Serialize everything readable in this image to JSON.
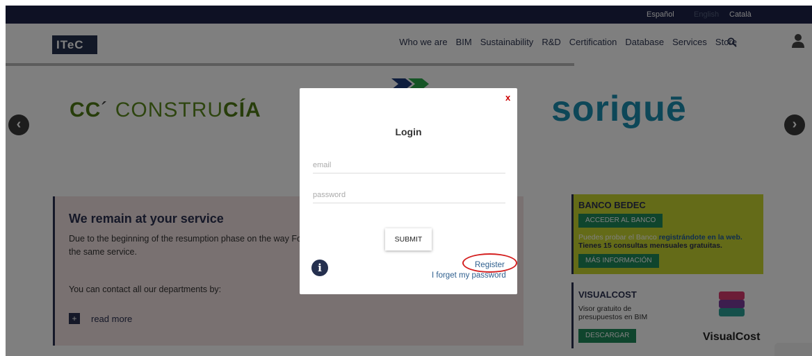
{
  "languages": [
    {
      "label": "Español",
      "active": true
    },
    {
      "label": "English",
      "active": false
    },
    {
      "label": "Català",
      "active": true
    }
  ],
  "header": {
    "logo": "ITeC",
    "menu": [
      "Who we are",
      "BIM",
      "Sustainability",
      "R&D",
      "Certification",
      "Database",
      "Services",
      "Store"
    ],
    "icons": {
      "search": "search-icon",
      "user": "user-icon"
    }
  },
  "slider": {
    "left_logo_a": "CC",
    "left_logo_b": "CONSTRU",
    "left_logo_c": "CÍA",
    "right_logo": "soriguē",
    "prev": "‹",
    "next": "›"
  },
  "content": {
    "title": "We remain at your service",
    "paragraph": "Due to the beginning of the resumption phase on the way Foundation are back operating, despite the fact that many the same service.",
    "contact": "You can contact all our departments by:",
    "read_more": "read more",
    "plus": "+"
  },
  "bedec": {
    "title": "BANCO BEDEC",
    "button": "ACCEDER AL BANCO",
    "text_a": "Puedes probar el Banco ",
    "text_link": "registrándote en la web.",
    "text_b": "Tienes 15 consultas mensuales gratuitas.",
    "more": "MÁS INFORMACIÓN"
  },
  "visualcost": {
    "title": "VISUALCOST",
    "text": "Visor gratuito de presupuestos en BIM",
    "button": "DESCARGAR",
    "brand": "VisualCost"
  },
  "login_modal": {
    "close": "x",
    "title": "Login",
    "email_placeholder": "email",
    "password_placeholder": "password",
    "submit": "SUBMIT",
    "info": "i",
    "register": "Register",
    "forgot": "I forget my password"
  },
  "colors": {
    "navy": "#1d2348",
    "accent_red": "#d41f1f",
    "bedec_green": "#c9d631",
    "button_green": "#1e8a5a"
  }
}
